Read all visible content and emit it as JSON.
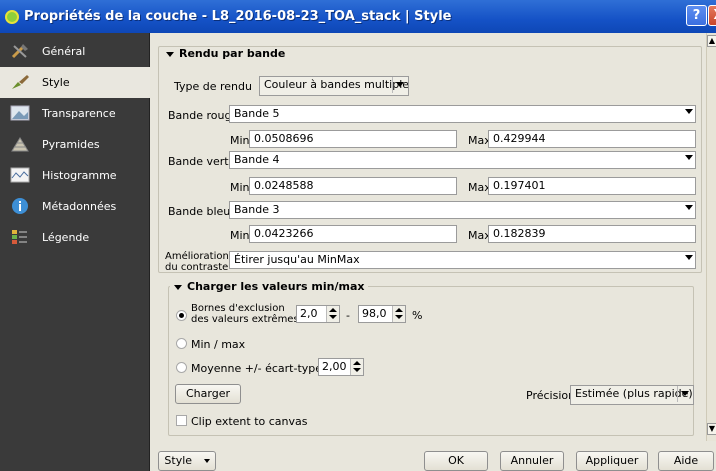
{
  "window": {
    "title": "Propriétés de la couche - L8_2016-08-23_TOA_stack | Style",
    "help_label": "?",
    "close_label": "X"
  },
  "sidebar": {
    "items": [
      {
        "label": "Général",
        "icon": "tools-icon"
      },
      {
        "label": "Style",
        "icon": "paintbrush-icon"
      },
      {
        "label": "Transparence",
        "icon": "transparency-icon"
      },
      {
        "label": "Pyramides",
        "icon": "pyramid-icon"
      },
      {
        "label": "Histogramme",
        "icon": "histogram-icon"
      },
      {
        "label": "Métadonnées",
        "icon": "info-icon"
      },
      {
        "label": "Légende",
        "icon": "legend-icon"
      }
    ],
    "selected": "Style"
  },
  "render": {
    "group_title": "Rendu par bande",
    "type_label": "Type de rendu",
    "type_value": "Couleur à bandes multiples",
    "red_label": "Bande rouge",
    "red_value": "Bande 5",
    "red_min": "0.0508696",
    "red_max": "0.429944",
    "green_label": "Bande verte",
    "green_value": "Bande 4",
    "green_min": "0.0248588",
    "green_max": "0.197401",
    "blue_label": "Bande bleue",
    "blue_value": "Bande 3",
    "blue_min": "0.0423266",
    "blue_max": "0.182839",
    "min_label": "Min",
    "max_label": "Max",
    "contrast_label_1": "Amélioration",
    "contrast_label_2": "du contraste",
    "contrast_value": "Étirer jusqu'au MinMax"
  },
  "minmax": {
    "group_title": "Charger les valeurs min/max",
    "option_cut_1": "Bornes d'exclusion",
    "option_cut_2": "des valeurs extrêmes",
    "cut_low": "2,0",
    "cut_high": "98,0",
    "dash": "-",
    "percent": "%",
    "option_minmax": "Min / max",
    "option_stddev": "Moyenne +/- écart-type ×",
    "stddev_value": "2,00",
    "load_button": "Charger",
    "precision_label": "Précision",
    "precision_value": "Estimée (plus rapide)",
    "clip_label": "Clip extent to canvas"
  },
  "footer": {
    "style_button": "Style",
    "ok": "OK",
    "cancel": "Annuler",
    "apply": "Appliquer",
    "help": "Aide"
  },
  "colors": {
    "title_blue": "#1552c6",
    "sidebar_bg": "#3a3a3a",
    "panel_bg": "#e8e6dc"
  }
}
